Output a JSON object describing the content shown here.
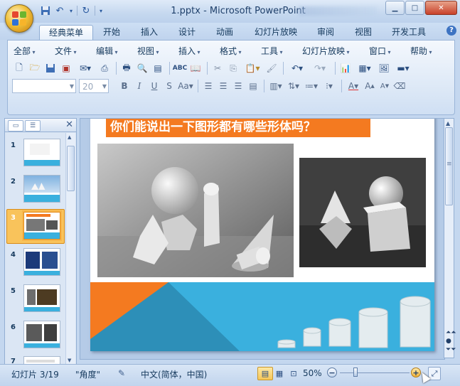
{
  "window": {
    "title": "1.pptx - Microsoft PowerPoint"
  },
  "ribbon_tabs": [
    "经典菜单",
    "开始",
    "插入",
    "设计",
    "动画",
    "幻灯片放映",
    "审阅",
    "视图",
    "开发工具"
  ],
  "classic_menu": [
    "全部",
    "文件",
    "编辑",
    "视图",
    "插入",
    "格式",
    "工具",
    "幻灯片放映",
    "窗口",
    "帮助"
  ],
  "font": {
    "name": "",
    "size": "20"
  },
  "slides_pane": {
    "thumbnail_numbers": [
      "1",
      "2",
      "3",
      "4",
      "5",
      "6",
      "7"
    ],
    "selected": "3"
  },
  "slide": {
    "title": "你们能说出一下图形都有哪些形体吗？"
  },
  "status": {
    "slide_info": "幻灯片 3/19",
    "theme": "\"角度\"",
    "language": "中文(简体，中国)",
    "zoom": "50%"
  },
  "colors": {
    "accent_orange": "#f47a20",
    "band_blue": "#3ab0de",
    "band_teal": "#2d8fb8"
  }
}
